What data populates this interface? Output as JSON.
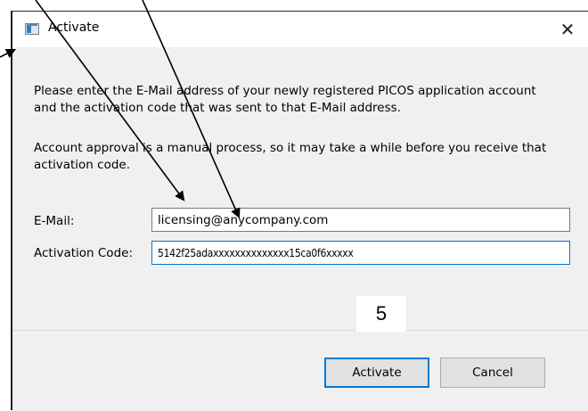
{
  "window": {
    "title": "Activate",
    "close_glyph": "✕"
  },
  "message": {
    "line1": "Please enter the E-Mail address of your newly registered PICOS application account and the activation code that was sent to that E-Mail address.",
    "line2": "Account approval is a manual process, so it may take a while before you receive that activation code."
  },
  "form": {
    "email_label": "E-Mail:",
    "email_value": "licensing@anycompany.com",
    "code_label": "Activation Code:",
    "code_value": "5142f25adaxxxxxxxxxxxxxx15ca0f6xxxxx"
  },
  "buttons": {
    "activate": "Activate",
    "cancel": "Cancel"
  },
  "annotation": {
    "step_number": "5",
    "arrow_color": "#000000"
  },
  "icons": {
    "app": "window-app-icon",
    "close": "close-icon"
  }
}
